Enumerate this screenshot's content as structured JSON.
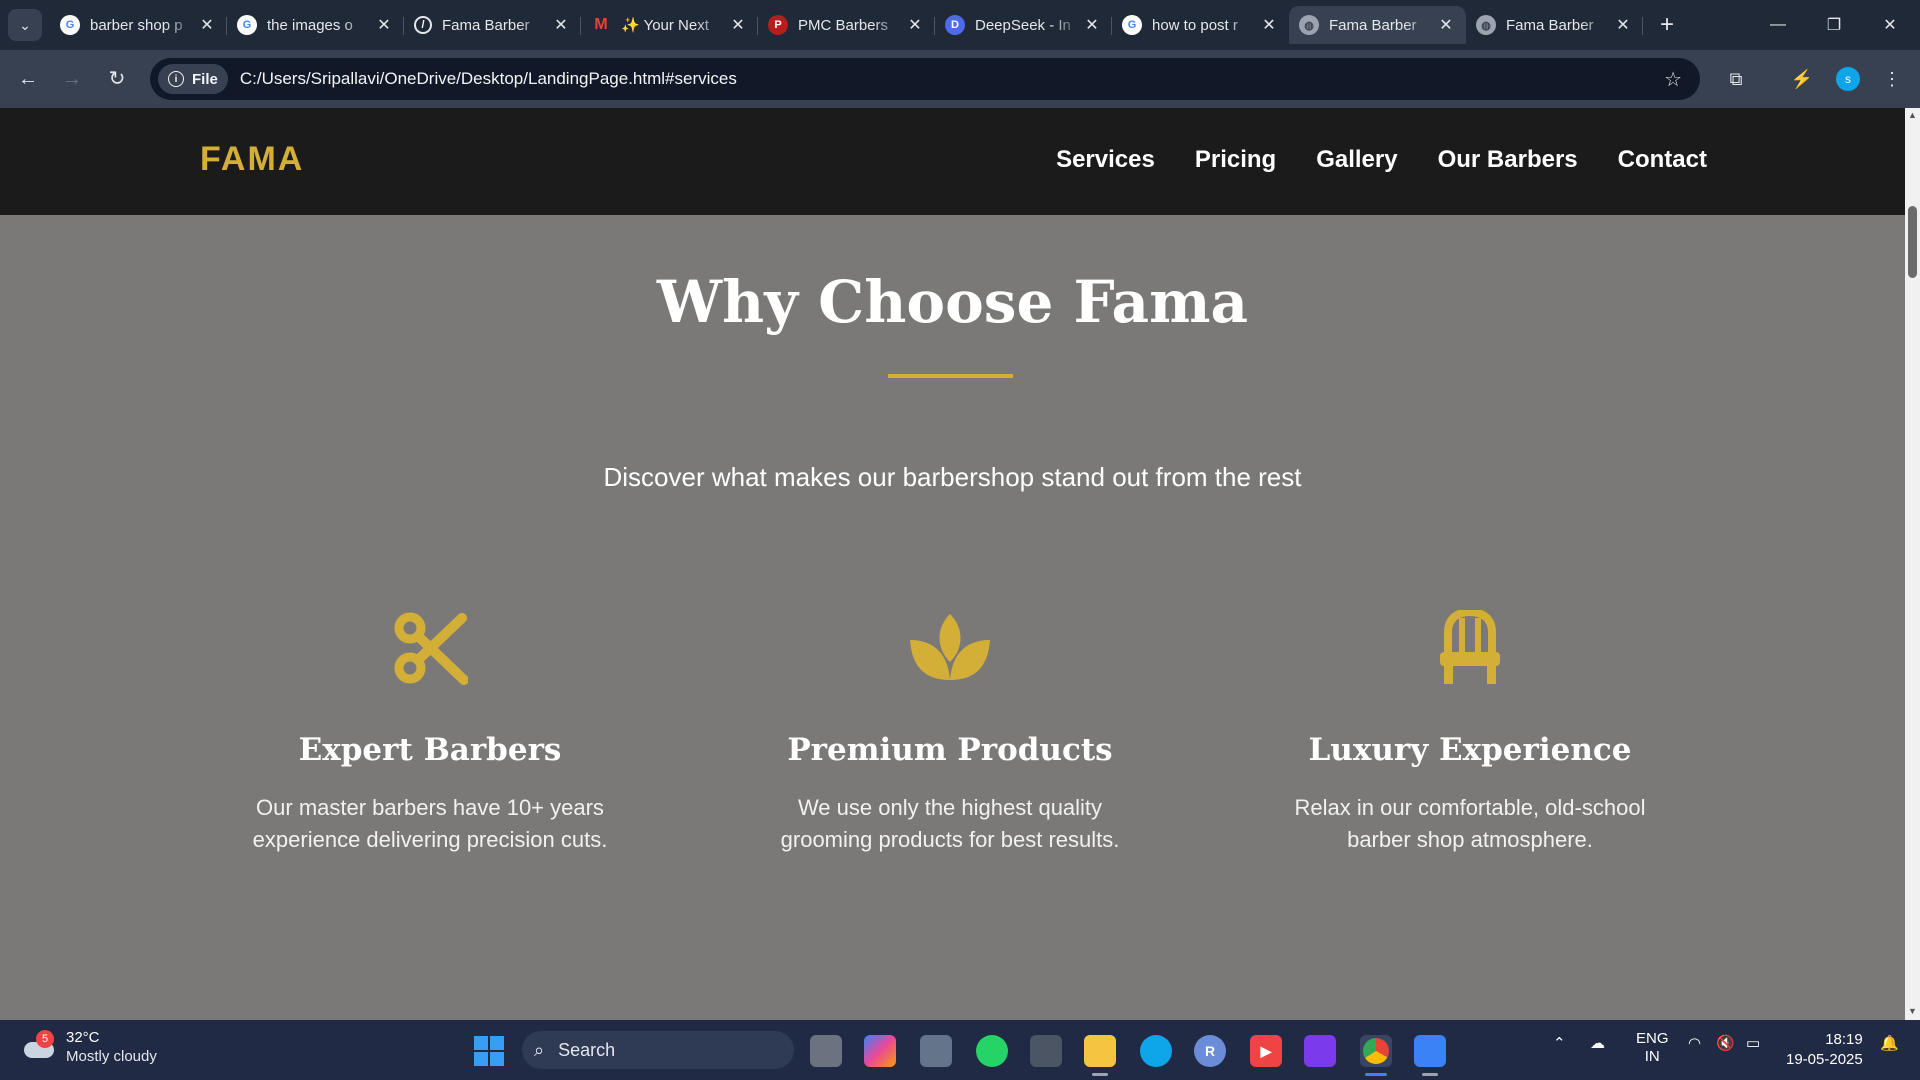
{
  "browser": {
    "tabs": [
      {
        "title": "barber shop p",
        "favicon": "google-icon",
        "color": "#ffffff"
      },
      {
        "title": "the images o",
        "favicon": "google-icon",
        "color": "#ffffff"
      },
      {
        "title": "Fama Barber",
        "favicon": "slash-circle-icon",
        "color": "#ffffff"
      },
      {
        "title": "✨ Your Next",
        "favicon": "gmail-icon",
        "color": "#ea4335"
      },
      {
        "title": "PMC Barbers",
        "favicon": "pmc-icon",
        "color": "#b91c1c"
      },
      {
        "title": "DeepSeek - In",
        "favicon": "deepseek-icon",
        "color": "#4f6bed"
      },
      {
        "title": "how to post r",
        "favicon": "google-icon",
        "color": "#ffffff"
      },
      {
        "title": "Fama Barber",
        "favicon": "globe-icon",
        "color": "#9ca3af",
        "active": true
      },
      {
        "title": "Fama Barber",
        "favicon": "globe-icon",
        "color": "#9ca3af"
      }
    ],
    "new_tab": "+",
    "chip_label": "File",
    "url": "C:/Users/Sripallavi/OneDrive/Desktop/LandingPage.html#services",
    "profile_initial": "s"
  },
  "site": {
    "logo": "FAMA",
    "accent": "#d4af37",
    "nav": [
      "Services",
      "Pricing",
      "Gallery",
      "Our Barbers",
      "Contact"
    ],
    "section": {
      "title": "Why Choose Fama",
      "subtitle": "Discover what makes our barbershop stand out from the rest",
      "features": [
        {
          "icon": "scissors-icon",
          "title": "Expert Barbers",
          "text": "Our master barbers have 10+ years experience delivering precision cuts."
        },
        {
          "icon": "lotus-icon",
          "title": "Premium Products",
          "text": "We use only the highest quality grooming products for best results."
        },
        {
          "icon": "chair-icon",
          "title": "Luxury Experience",
          "text": "Relax in our comfortable, old-school barber shop atmosphere."
        }
      ]
    }
  },
  "taskbar": {
    "weather_badge": "5",
    "temperature": "32°C",
    "condition": "Mostly cloudy",
    "search_label": "Search",
    "language": "ENG",
    "region": "IN",
    "time": "18:19",
    "date": "19-05-2025"
  }
}
